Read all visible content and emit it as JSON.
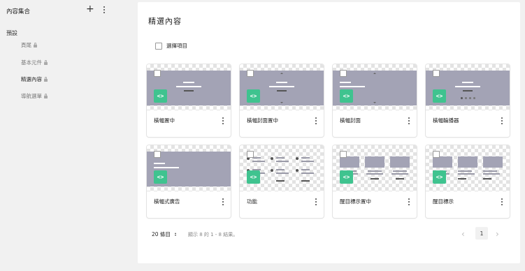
{
  "sidebar": {
    "title": "內容集合",
    "add_icon": "+",
    "section": "預設",
    "items": [
      {
        "label": "頁尾",
        "active": false
      },
      {
        "label": "基本元件",
        "active": false
      },
      {
        "label": "精選內容",
        "active": true
      },
      {
        "label": "導航選單",
        "active": false
      }
    ]
  },
  "main": {
    "title": "精選內容",
    "select_all": "選擇項目",
    "cards": [
      {
        "label": "橫幅置中",
        "variant": "banner-center"
      },
      {
        "label": "橫幅封面置中",
        "variant": "banner-cover-center"
      },
      {
        "label": "橫幅封面",
        "variant": "banner-cover"
      },
      {
        "label": "橫幅輪播器",
        "variant": "banner-carousel"
      },
      {
        "label": "橫幅式廣告",
        "variant": "banner-ad"
      },
      {
        "label": "功能",
        "variant": "features"
      },
      {
        "label": "醒目標示置中",
        "variant": "highlight-center"
      },
      {
        "label": "醒目標示",
        "variant": "highlight"
      }
    ],
    "code_icon": "<>"
  },
  "pager": {
    "per_page": "20 條目",
    "showing": "顯示 8 的 1 - 8 結果。",
    "prev": "‹",
    "current_page": "1",
    "next": "›"
  },
  "colors": {
    "accent": "#3fc38f",
    "thumb_gray": "#a3a3b5",
    "background": "#f1f1f1"
  }
}
